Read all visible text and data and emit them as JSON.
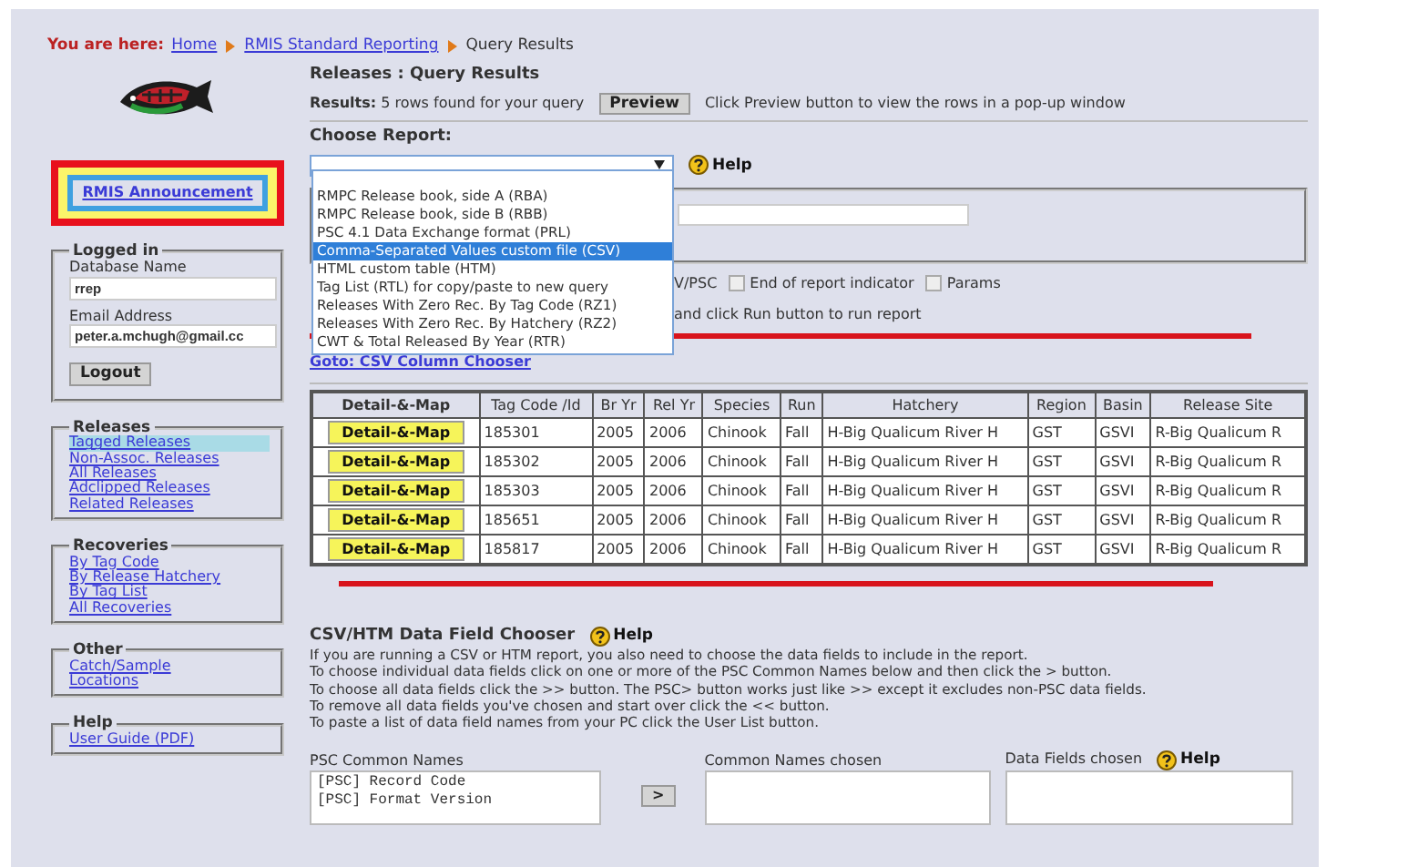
{
  "breadcrumb": {
    "label": "You are here:",
    "links": [
      "Home",
      "RMIS Standard Reporting"
    ],
    "current": "Query Results"
  },
  "sidebar": {
    "announcement": "RMIS Announcement",
    "login": {
      "title": "Logged in",
      "fields": [
        {
          "label": "Database Name",
          "value": "rrep"
        },
        {
          "label": "Email Address",
          "value": "peter.a.mchugh@gmail.cc"
        }
      ],
      "button": "Logout"
    },
    "sections": [
      {
        "title": "Releases",
        "items": [
          {
            "label": "Tagged Releases",
            "selected": true
          },
          {
            "label": "Non-Assoc. Releases",
            "selected": false
          },
          {
            "label": "All Releases",
            "selected": false
          },
          {
            "label": "Adclipped Releases",
            "selected": false
          },
          {
            "label": "Related Releases",
            "selected": false
          }
        ]
      },
      {
        "title": "Recoveries",
        "items": [
          {
            "label": "By Tag Code",
            "selected": false
          },
          {
            "label": "By Release Hatchery",
            "selected": false
          },
          {
            "label": "By Tag List",
            "selected": false
          },
          {
            "label": "All Recoveries",
            "selected": false
          }
        ]
      },
      {
        "title": "Other",
        "items": [
          {
            "label": "Catch/Sample",
            "selected": false
          },
          {
            "label": "Locations",
            "selected": false
          }
        ]
      },
      {
        "title": "Help",
        "items": [
          {
            "label": "User Guide (PDF)",
            "selected": false
          }
        ]
      }
    ]
  },
  "main": {
    "title": "Releases : Query Results",
    "results": {
      "label": "Results:",
      "text": "5 rows found for your query",
      "button": "Preview",
      "hint": "Click Preview button to view the rows in a pop-up window"
    },
    "report": {
      "label": "Choose Report:",
      "help": "Help",
      "options": [
        {
          "label": "RMPC Release book, side A (RBA)",
          "selected": false
        },
        {
          "label": "RMPC Release book, side B (RBB)",
          "selected": false
        },
        {
          "label": "PSC 4.1 Data Exchange format (PRL)",
          "selected": false
        },
        {
          "label": "Comma-Separated Values custom file (CSV)",
          "selected": true
        },
        {
          "label": "HTML custom table (HTM)",
          "selected": false
        },
        {
          "label": "Tag List (RTL) for copy/paste to new query",
          "selected": false
        },
        {
          "label": "Releases With Zero Rec. By Tag Code (RZ1)",
          "selected": false
        },
        {
          "label": "Releases With Zero Rec. By Hatchery (RZ2)",
          "selected": false
        },
        {
          "label": "CWT & Total Released By Year (RTR)",
          "selected": false
        }
      ]
    },
    "options_row": {
      "text": "V/PSC",
      "checkboxes": [
        {
          "label": "End of report indicator",
          "checked": false
        },
        {
          "label": "Params",
          "checked": false
        }
      ]
    },
    "run_hint": "and click Run button to run report",
    "goto_link": "Goto: CSV Column Chooser",
    "table": {
      "columns": [
        "Detail-&-Map",
        "Tag Code /Id",
        "Br Yr",
        "Rel Yr",
        "Species",
        "Run",
        "Hatchery",
        "Region",
        "Basin",
        "Release Site"
      ],
      "rows": [
        [
          "Detail-&-Map",
          "185301",
          "2005",
          "2006",
          "Chinook",
          "Fall",
          "H-Big Qualicum River H",
          "GST",
          "GSVI",
          "R-Big Qualicum R"
        ],
        [
          "Detail-&-Map",
          "185302",
          "2005",
          "2006",
          "Chinook",
          "Fall",
          "H-Big Qualicum River H",
          "GST",
          "GSVI",
          "R-Big Qualicum R"
        ],
        [
          "Detail-&-Map",
          "185303",
          "2005",
          "2006",
          "Chinook",
          "Fall",
          "H-Big Qualicum River H",
          "GST",
          "GSVI",
          "R-Big Qualicum R"
        ],
        [
          "Detail-&-Map",
          "185651",
          "2005",
          "2006",
          "Chinook",
          "Fall",
          "H-Big Qualicum River H",
          "GST",
          "GSVI",
          "R-Big Qualicum R"
        ],
        [
          "Detail-&-Map",
          "185817",
          "2005",
          "2006",
          "Chinook",
          "Fall",
          "H-Big Qualicum River H",
          "GST",
          "GSVI",
          "R-Big Qualicum R"
        ]
      ]
    },
    "chooser": {
      "title": "CSV/HTM Data Field Chooser",
      "help": "Help",
      "lines": [
        "If you are running a CSV or HTM report, you also need to choose the data fields to include in the report.",
        "To choose individual data fields click on one or more of the PSC Common Names below and then click the > button.",
        "To choose all data fields click the >> button. The PSC> button works just like >> except it excludes non-PSC data fields.",
        "To remove all data fields you've chosen and start over click the << button.",
        "To paste a list of data field names from your PC click the User List button."
      ],
      "common_names": {
        "label": "PSC Common Names",
        "items": [
          "[PSC] Record Code",
          "[PSC] Format Version"
        ]
      },
      "add_button": ">",
      "chosen_label": "Common Names chosen",
      "fields_label": "Data Fields chosen",
      "fields_help": "Help"
    }
  }
}
